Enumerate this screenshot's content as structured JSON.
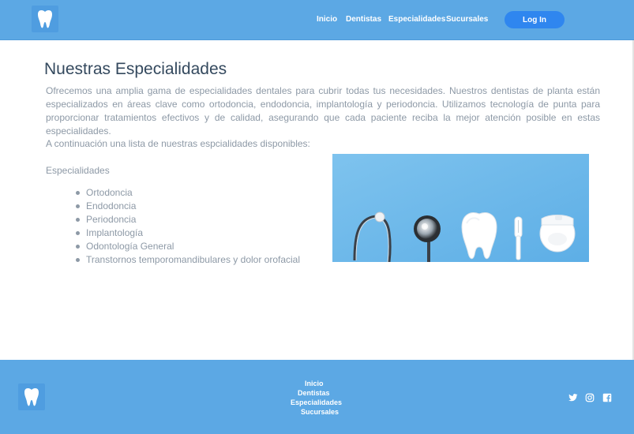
{
  "header": {
    "nav": [
      "Inicio",
      "Dentistas",
      "Especialidades",
      "Sucursales"
    ],
    "login_label": "Log In"
  },
  "main": {
    "title": "Nuestras Especialidades",
    "intro": "Ofrecemos una amplia gama de especialidades dentales para cubrir todas tus necesidades. Nuestros dentistas de planta están especializados en áreas clave como ortodoncia, endodoncia, implantología y periodoncia. Utilizamos tecnología de punta para proporcionar tratamientos efectivos y de calidad, asegurando que cada paciente reciba la mejor atención posible en estas especialidades.",
    "list_intro": "A continuación una lista de nuestras espcialidades disponibles:",
    "list_heading": "Especialidades",
    "specialties": [
      "Ortodoncia",
      "Endodoncia",
      "Periodoncia",
      "Implantología",
      "Odontología General",
      "Transtornos temporomandibulares y dolor orofacial"
    ]
  },
  "footer": {
    "links": [
      "Inicio",
      "Dentistas",
      "Especialidades",
      "Sucursales"
    ],
    "social_icons": [
      "twitter-icon",
      "instagram-icon",
      "facebook-icon"
    ]
  },
  "colors": {
    "brand_blue": "#5ca8e4",
    "button_blue": "#2f86ef",
    "title_text": "#34495e",
    "body_text": "#8d99a6"
  }
}
